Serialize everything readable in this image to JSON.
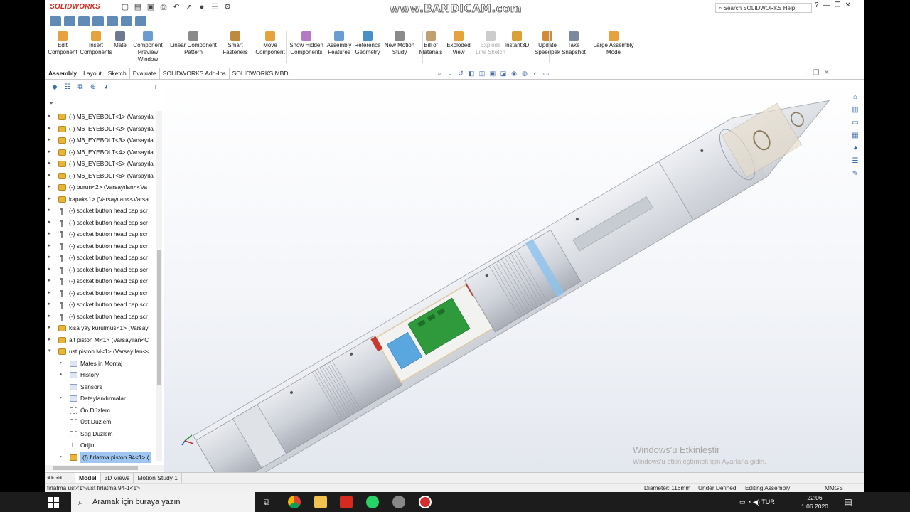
{
  "title_bar": {
    "logo": "SOLIDWORKS",
    "recorder_watermark": "www.BANDICAM.com",
    "search_placeholder": "Search SOLIDWORKS Help"
  },
  "command_manager": [
    {
      "label": "Edit\nComponent",
      "icon": "edit-component-icon"
    },
    {
      "label": "Insert\nComponents",
      "icon": "insert-components-icon"
    },
    {
      "label": "Mate",
      "icon": "mate-icon"
    },
    {
      "label": "Component\nPreview Window",
      "icon": "preview-window-icon"
    },
    {
      "label": "Linear Component\nPattern",
      "icon": "pattern-icon"
    },
    {
      "label": "Smart\nFasteners",
      "icon": "fasteners-icon"
    },
    {
      "label": "Move\nComponent",
      "icon": "move-component-icon"
    },
    {
      "label": "Show Hidden\nComponents",
      "icon": "show-hidden-icon"
    },
    {
      "label": "Assembly\nFeatures",
      "icon": "assembly-features-icon"
    },
    {
      "label": "Reference\nGeometry",
      "icon": "reference-geometry-icon"
    },
    {
      "label": "New Motion\nStudy",
      "icon": "motion-study-icon"
    },
    {
      "label": "Bill of\nMaterials",
      "icon": "bom-icon"
    },
    {
      "label": "Exploded\nView",
      "icon": "exploded-view-icon"
    },
    {
      "label": "Explode\nLine Sketch",
      "icon": "explode-line-icon",
      "disabled": true
    },
    {
      "label": "Instant3D",
      "icon": "instant3d-icon"
    },
    {
      "label": "Update\nSpeedpak",
      "icon": "speedpak-icon"
    },
    {
      "label": "Take\nSnapshot",
      "icon": "snapshot-icon"
    },
    {
      "label": "Large Assembly\nMode",
      "icon": "large-assembly-icon"
    }
  ],
  "tabs": [
    "Assembly",
    "Layout",
    "Sketch",
    "Evaluate",
    "SOLIDWORKS Add-Ins",
    "SOLIDWORKS MBD"
  ],
  "active_tab": "Assembly",
  "tree": [
    {
      "label": "(-) M6_EYEBOLT<1> (Varsayıla",
      "icon": "part"
    },
    {
      "label": "(-) M6_EYEBOLT<2> (Varsayıla",
      "icon": "part"
    },
    {
      "label": "(-) M6_EYEBOLT<3> (Varsayıla",
      "icon": "part"
    },
    {
      "label": "(-) M6_EYEBOLT<4> (Varsayıla",
      "icon": "part"
    },
    {
      "label": "(-) M6_EYEBOLT<5> (Varsayıla",
      "icon": "part"
    },
    {
      "label": "(-) M6_EYEBOLT<6> (Varsayıla",
      "icon": "part"
    },
    {
      "label": "(-) burun<2> (Varsayılan<<Va",
      "icon": "part"
    },
    {
      "label": "kapak<1> (Varsayılan<<Varsa",
      "icon": "part"
    },
    {
      "label": "(-) socket button head cap scr",
      "icon": "screw"
    },
    {
      "label": "(-) socket button head cap scr",
      "icon": "screw"
    },
    {
      "label": "(-) socket button head cap scr",
      "icon": "screw"
    },
    {
      "label": "(-) socket button head cap scr",
      "icon": "screw"
    },
    {
      "label": "(-) socket button head cap scr",
      "icon": "screw"
    },
    {
      "label": "(-) socket button head cap scr",
      "icon": "screw"
    },
    {
      "label": "(-) socket button head cap scr",
      "icon": "screw"
    },
    {
      "label": "(-) socket button head cap scr",
      "icon": "screw"
    },
    {
      "label": "(-) socket button head cap scr",
      "icon": "screw"
    },
    {
      "label": "(-) socket button head cap scr",
      "icon": "screw"
    },
    {
      "label": "kisa yay kurulmus<1> (Varsay",
      "icon": "part"
    },
    {
      "label": "alt piston M<1> (Varsayılan<C",
      "icon": "part"
    },
    {
      "label": "ust piston M<1> (Varsayılan<<",
      "icon": "part",
      "expanded": true
    },
    {
      "label": "Mates in Montaj",
      "icon": "folder",
      "indent": 1
    },
    {
      "label": "History",
      "icon": "folder",
      "indent": 1
    },
    {
      "label": "Sensors",
      "icon": "folder",
      "indent": 1,
      "noexp": true
    },
    {
      "label": "Detaylandırmalar",
      "icon": "folder",
      "indent": 1
    },
    {
      "label": "Ön Düzlem",
      "icon": "plane",
      "indent": 1,
      "noexp": true
    },
    {
      "label": "Üst Düzlem",
      "icon": "plane",
      "indent": 1,
      "noexp": true
    },
    {
      "label": "Sağ Düzlem",
      "icon": "plane",
      "indent": 1,
      "noexp": true
    },
    {
      "label": "Orijin",
      "icon": "origin",
      "indent": 1,
      "noexp": true
    },
    {
      "label": "(f) firlatma piston 94<1> (",
      "icon": "part",
      "indent": 1,
      "selected": true
    }
  ],
  "bottom_tabs": [
    "Model",
    "3D Views",
    "Motion Study 1"
  ],
  "active_bottom_tab": "Model",
  "status": {
    "left": "firlatma ust<1>/ust firlatma 94-1<1>",
    "diameter": "Diameter: 116mm",
    "defined": "Under Defined",
    "editing": "Editing Assembly",
    "units": "MMGS"
  },
  "activation": {
    "title": "Windows'u Etkinleştir",
    "subtitle": "Windows'u etkinleştirmek için Ayarlar'a gidin."
  },
  "taskbar": {
    "search_placeholder": "Aramak için buraya yazın",
    "language": "TUR",
    "time": "22:06",
    "date": "1.06.2020"
  },
  "colors": {
    "solidworks_red": "#d52b1e",
    "selection": "#9fc6f0",
    "pcb_green": "#2e9a3c",
    "accent_blue": "#5aa7e0"
  }
}
